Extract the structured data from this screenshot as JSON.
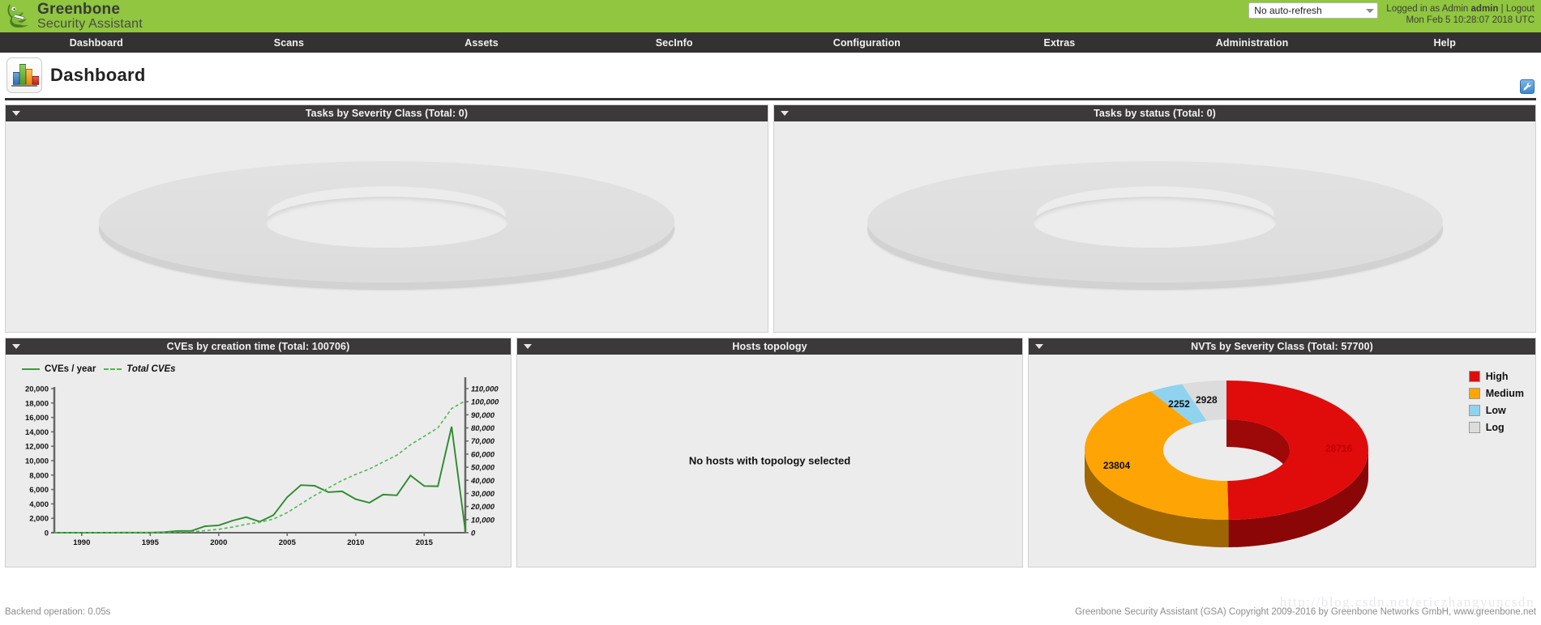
{
  "header": {
    "brand_line1": "Greenbone",
    "brand_line2": "Security Assistant",
    "logo_icon": "greenbone-dragon-logo",
    "refresh_select_value": "No auto-refresh",
    "refresh_caret_icon": "chevron-down-icon",
    "login_prefix": "Logged in as  Admin",
    "login_user": "admin",
    "login_separator": "|",
    "logout_label": "Logout",
    "server_time": "Mon Feb 5 10:28:07 2018 UTC"
  },
  "nav": {
    "items": [
      {
        "label": "Dashboard"
      },
      {
        "label": "Scans"
      },
      {
        "label": "Assets"
      },
      {
        "label": "SecInfo"
      },
      {
        "label": "Configuration"
      },
      {
        "label": "Extras"
      },
      {
        "label": "Administration"
      },
      {
        "label": "Help"
      }
    ]
  },
  "page": {
    "title": "Dashboard",
    "icon": "bar-chart-icon",
    "edit_icon": "wrench-icon"
  },
  "panels": {
    "tasks_by_severity": {
      "title": "Tasks by Severity Class (Total: 0)",
      "collapse_icon": "triangle-down-icon",
      "empty": true
    },
    "tasks_by_status": {
      "title": "Tasks by status (Total: 0)",
      "collapse_icon": "triangle-down-icon",
      "empty": true
    },
    "cves_by_creation_time": {
      "title": "CVEs by creation time (Total: 100706)",
      "collapse_icon": "triangle-down-icon"
    },
    "hosts_topology": {
      "title": "Hosts topology",
      "collapse_icon": "triangle-down-icon",
      "message": "No hosts with topology selected"
    },
    "nvts_by_severity": {
      "title": "NVTs by Severity Class (Total: 57700)",
      "collapse_icon": "triangle-down-icon"
    }
  },
  "chart_data": [
    {
      "type": "line",
      "title": "CVEs by creation time (Total: 100706)",
      "xlabel": "",
      "ylabel": "",
      "grid": false,
      "legend_position": "top-left",
      "xlim": [
        1988,
        2018
      ],
      "ylim": [
        0,
        20000
      ],
      "y2lim": [
        0,
        110000
      ],
      "xticks": [
        1990,
        1995,
        2000,
        2005,
        2010,
        2015
      ],
      "yticks": [
        0,
        2000,
        4000,
        6000,
        8000,
        10000,
        12000,
        14000,
        16000,
        18000,
        20000
      ],
      "yticklabels": [
        "0",
        "2,000",
        "4,000",
        "6,000",
        "8,000",
        "10,000",
        "12,000",
        "14,000",
        "16,000",
        "18,000",
        "20,000"
      ],
      "y2ticks": [
        0,
        10000,
        20000,
        30000,
        40000,
        50000,
        60000,
        70000,
        80000,
        90000,
        100000,
        110000
      ],
      "y2ticklabels": [
        "0",
        "10,000",
        "20,000",
        "30,000",
        "40,000",
        "50,000",
        "60,000",
        "70,000",
        "80,000",
        "90,000",
        "100,000",
        "110,000"
      ],
      "x": [
        1988,
        1989,
        1990,
        1991,
        1992,
        1993,
        1994,
        1995,
        1996,
        1997,
        1998,
        1999,
        2000,
        2001,
        2002,
        2003,
        2004,
        2005,
        2006,
        2007,
        2008,
        2009,
        2010,
        2011,
        2012,
        2013,
        2014,
        2015,
        2016,
        2017,
        2018
      ],
      "series": [
        {
          "name": "CVEs / year",
          "axis": "left",
          "style": "solid",
          "color": "#2e8b2e",
          "values": [
            2,
            5,
            12,
            16,
            16,
            20,
            25,
            25,
            75,
            252,
            246,
            894,
            1020,
            1677,
            2156,
            1527,
            2451,
            4935,
            6610,
            6520,
            5632,
            5736,
            4653,
            4155,
            5297,
            5191,
            7946,
            6480,
            6447,
            14714,
            300
          ]
        },
        {
          "name": "Total CVEs",
          "axis": "right",
          "style": "dashed",
          "color": "#4fb84f",
          "values": [
            2,
            7,
            19,
            35,
            51,
            71,
            96,
            121,
            196,
            448,
            694,
            1588,
            2608,
            4285,
            6441,
            7968,
            10419,
            15354,
            21964,
            28484,
            34116,
            39852,
            44505,
            48660,
            53957,
            59148,
            67094,
            73574,
            80021,
            94735,
            100706
          ]
        }
      ]
    },
    {
      "type": "pie",
      "variant": "donut-3d",
      "title": "NVTs by Severity Class (Total: 57700)",
      "total": 57700,
      "legend_position": "right",
      "labels": [
        "High",
        "Medium",
        "Low",
        "Log"
      ],
      "values": [
        28716,
        23804,
        2252,
        2928
      ],
      "colors": [
        "#e00b0b",
        "#ffa405",
        "#8fd3ef",
        "#dcdcdc"
      ]
    },
    {
      "type": "pie",
      "variant": "donut-3d",
      "title": "Tasks by Severity Class (Total: 0)",
      "total": 0,
      "labels": [],
      "values": [],
      "colors": []
    },
    {
      "type": "pie",
      "variant": "donut-3d",
      "title": "Tasks by status (Total: 0)",
      "total": 0,
      "labels": [],
      "values": [],
      "colors": []
    }
  ],
  "nvt_slice_labels": [
    {
      "text": "28716",
      "color": "#c00000"
    },
    {
      "text": "23804",
      "color": "#111111"
    },
    {
      "text": "2252",
      "color": "#111111"
    },
    {
      "text": "2928",
      "color": "#111111"
    }
  ],
  "footer": {
    "backend": "Backend operation: 0.05s",
    "copyright": "Greenbone Security Assistant (GSA) Copyright 2009-2016 by Greenbone Networks GmbH, www.greenbone.net",
    "watermark": "http://blog.csdn.net/ericzhangyuncsdn"
  },
  "colors": {
    "brand_green": "#90c640",
    "nav_dark": "#333132",
    "panel_bg": "#ececec",
    "high": "#e00b0b",
    "medium": "#ffa405",
    "low": "#8fd3ef",
    "log": "#dcdcdc",
    "line_green": "#2e8b2e"
  }
}
